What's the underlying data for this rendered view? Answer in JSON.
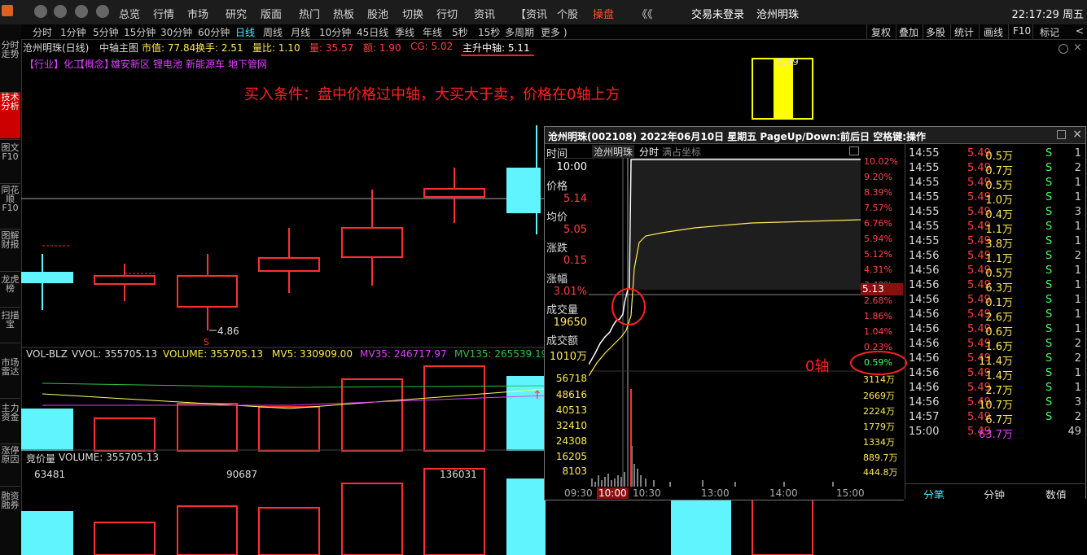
{
  "topbar": {
    "items": [
      "总览",
      "行情",
      "市场",
      "研究",
      "版面",
      "热门",
      "热板",
      "股池",
      "切换",
      "行切",
      "资讯",
      "【资讯",
      "个股",
      "操盘",
      "《《",
      "交易未登录",
      "沧州明珠"
    ],
    "clock": "22:17:29 周五"
  },
  "toolbar": {
    "timeframes": [
      "分时",
      "1分钟",
      "5分钟",
      "15分钟",
      "30分钟",
      "60分钟",
      "日线",
      "周线",
      "月线",
      "10分钟",
      "45日线",
      "季线",
      "年线",
      "5秒",
      "15秒",
      "多周期",
      "更多 )"
    ],
    "right": [
      "复权",
      "叠加",
      "多股",
      "统计",
      "画线",
      "F10",
      "标记",
      "<"
    ]
  },
  "sidebar": [
    "分时走势",
    "技术分析",
    "图文F10",
    "同花顺F10",
    "图解财报",
    "龙虎榜",
    "扫描宝",
    "市场雷达",
    "主力资金",
    "涨停原因",
    "融资融券"
  ],
  "info": {
    "stock": "沧州明珠(日线)",
    "main": "中轴主图",
    "mcap": "市值: 77.84",
    "turnover": "换手: 2.51",
    "volratio": "量比: 1.10",
    "liang": "量: 35.57",
    "e": "额: 1.90",
    "cg": "CG: 5.02",
    "zhongzhou": "主升中轴: 5.11"
  },
  "tags": [
    "【行业】化工",
    "【概念】",
    "雄安新区",
    "锂电池",
    "新能源车",
    "地下管网"
  ],
  "annotation": "买入条件：盘中价格过中轴，大买大于卖，价格在0轴上方",
  "kchart": {
    "low_label": "4.86",
    "s_mark": "S",
    "high_label": "5.49"
  },
  "vol_panel": {
    "header": "VOL-BLZ",
    "vvol": "VVOL: 355705.13",
    "volume": "VOLUME: 355705.13",
    "mv5": "MV5: 330909.00",
    "mv35": "MV35: 246717.97",
    "mv135": "MV135: 265539.19"
  },
  "bid_panel": {
    "header": "竞价量",
    "volume": "VOLUME: 355705.13",
    "labels": [
      "63481",
      "90687",
      "136031"
    ]
  },
  "popup": {
    "title": "沧州明珠(002108)  2022年06月10日 星期五 PageUp/Down:前后日 空格键:操作",
    "tabs": [
      "时间",
      "沧州明珠",
      "分时",
      "满占坐标"
    ],
    "left": [
      {
        "label": "时间",
        "value": "10:00"
      },
      {
        "label": "价格",
        "value": "5.14"
      },
      {
        "label": "均价",
        "value": "5.05"
      },
      {
        "label": "涨跌",
        "value": "0.15"
      },
      {
        "label": "涨幅",
        "value": "3.01%"
      },
      {
        "label": "成交量",
        "value": "19650"
      },
      {
        "label": "成交额",
        "value": "1010万"
      }
    ],
    "pct_labels": [
      "10.02%",
      "9.20%",
      "8.39%",
      "7.57%",
      "6.76%",
      "5.94%",
      "5.12%",
      "4.31%",
      "3.49%",
      "2.68%",
      "1.86%",
      "1.04%",
      "0.23%",
      "0.59%"
    ],
    "cursor_price": "5.13",
    "vol_left": [
      "56718",
      "48616",
      "40513",
      "32410",
      "24308",
      "16205",
      "8103"
    ],
    "vol_right": [
      "3114万",
      "2669万",
      "2224万",
      "1779万",
      "1334万",
      "889.7万",
      "444.8万"
    ],
    "times": [
      "09:30",
      "10:00",
      "10:30",
      "13:00",
      "14:00",
      "15:00"
    ],
    "zero_axis_label": "0轴",
    "zero_axis_pct": "0.59%"
  },
  "ticks": [
    [
      "14:55",
      "5.49",
      "0.5万",
      "S",
      "1"
    ],
    [
      "14:55",
      "5.49",
      "0.7万",
      "S",
      "2"
    ],
    [
      "14:55",
      "5.49",
      "0.5万",
      "S",
      "1"
    ],
    [
      "14:55",
      "5.49",
      "1.0万",
      "S",
      "1"
    ],
    [
      "14:55",
      "5.49",
      "0.4万",
      "S",
      "3"
    ],
    [
      "14:55",
      "5.49",
      "1.1万",
      "S",
      "1"
    ],
    [
      "14:55",
      "5.49",
      "3.8万",
      "S",
      "1"
    ],
    [
      "14:56",
      "5.49",
      "1.1万",
      "S",
      "2"
    ],
    [
      "14:56",
      "5.49",
      "0.5万",
      "S",
      "1"
    ],
    [
      "14:56",
      "5.49",
      "6.3万",
      "S",
      "1"
    ],
    [
      "14:56",
      "5.49",
      "0.1万",
      "S",
      "1"
    ],
    [
      "14:56",
      "5.49",
      "2.6万",
      "S",
      "1"
    ],
    [
      "14:56",
      "5.49",
      "0.6万",
      "S",
      "1"
    ],
    [
      "14:56",
      "5.49",
      "1.6万",
      "S",
      "2"
    ],
    [
      "14:56",
      "5.49",
      "11.4万",
      "S",
      "2"
    ],
    [
      "14:56",
      "5.49",
      "1.4万",
      "S",
      "1"
    ],
    [
      "14:56",
      "5.49",
      "2.7万",
      "S",
      "1"
    ],
    [
      "14:56",
      "5.49",
      "10.7万",
      "S",
      "3"
    ],
    [
      "14:57",
      "5.49",
      "6.7万",
      "S",
      "2"
    ],
    [
      "15:00",
      "5.49",
      "63.7万",
      "",
      "49"
    ]
  ],
  "bottom_tabs": [
    "分笔",
    "分钟",
    "数值"
  ],
  "colors": {
    "up": "#ff3030",
    "down": "#5ff4ff",
    "yellow": "#ffff00",
    "magenta": "#e040ff",
    "green": "#30ff60"
  }
}
